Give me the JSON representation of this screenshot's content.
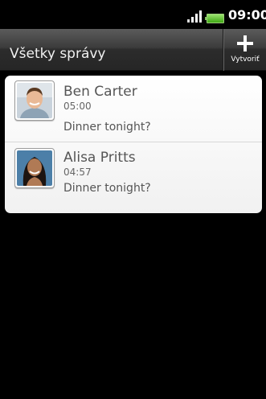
{
  "status_bar": {
    "time": "09:00"
  },
  "header": {
    "title": "Všetky správy",
    "compose_label": "Vytvoriť"
  },
  "messages": [
    {
      "name": "Ben Carter",
      "time": "05:00",
      "preview": "Dinner tonight?"
    },
    {
      "name": "Alisa Pritts",
      "time": "04:57",
      "preview": "Dinner tonight?"
    }
  ]
}
